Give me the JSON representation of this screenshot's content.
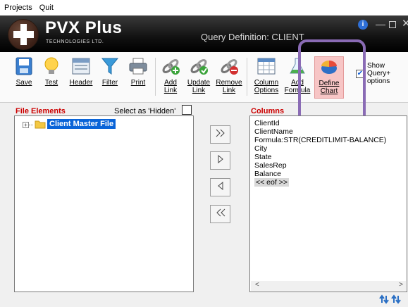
{
  "menu": {
    "projects": "Projects",
    "quit": "Quit"
  },
  "header": {
    "brand": "PVX Plus",
    "tagline": "TECHNOLOGIES LTD.",
    "title": "Query Definition: CLIENT"
  },
  "toolbar": {
    "save": "Save",
    "test": "Test",
    "header": "Header",
    "filter": "Filter",
    "print": "Print",
    "add_link": "Add\nLink",
    "update_link": "Update\nLink",
    "remove_link": "Remove\nLink",
    "column_options": "Column\nOptions",
    "add_formula": "Add\nFormula",
    "define_chart": "Define\nChart",
    "show_query_options": "Show\nQuery+\noptions"
  },
  "file_elements": {
    "label": "File Elements",
    "hidden_label": "Select as 'Hidden'",
    "tree_item": "Client Master File"
  },
  "move_buttons": {
    "add_one": "ᐅᐅ",
    "add": "ᐅ",
    "remove": "ᐊ",
    "remove_all": "ᐊᐊ"
  },
  "columns": {
    "label": "Columns",
    "items": [
      "ClientId",
      "ClientName",
      "Formula:STR(CREDITLIMIT-BALANCE)",
      "City",
      "State",
      "SalesRep",
      "Balance",
      "<< eof >>"
    ]
  },
  "colors": {
    "accent_red": "#cc0000",
    "selection_blue": "#0a64d8",
    "highlight_purple": "#8a6bb5"
  }
}
